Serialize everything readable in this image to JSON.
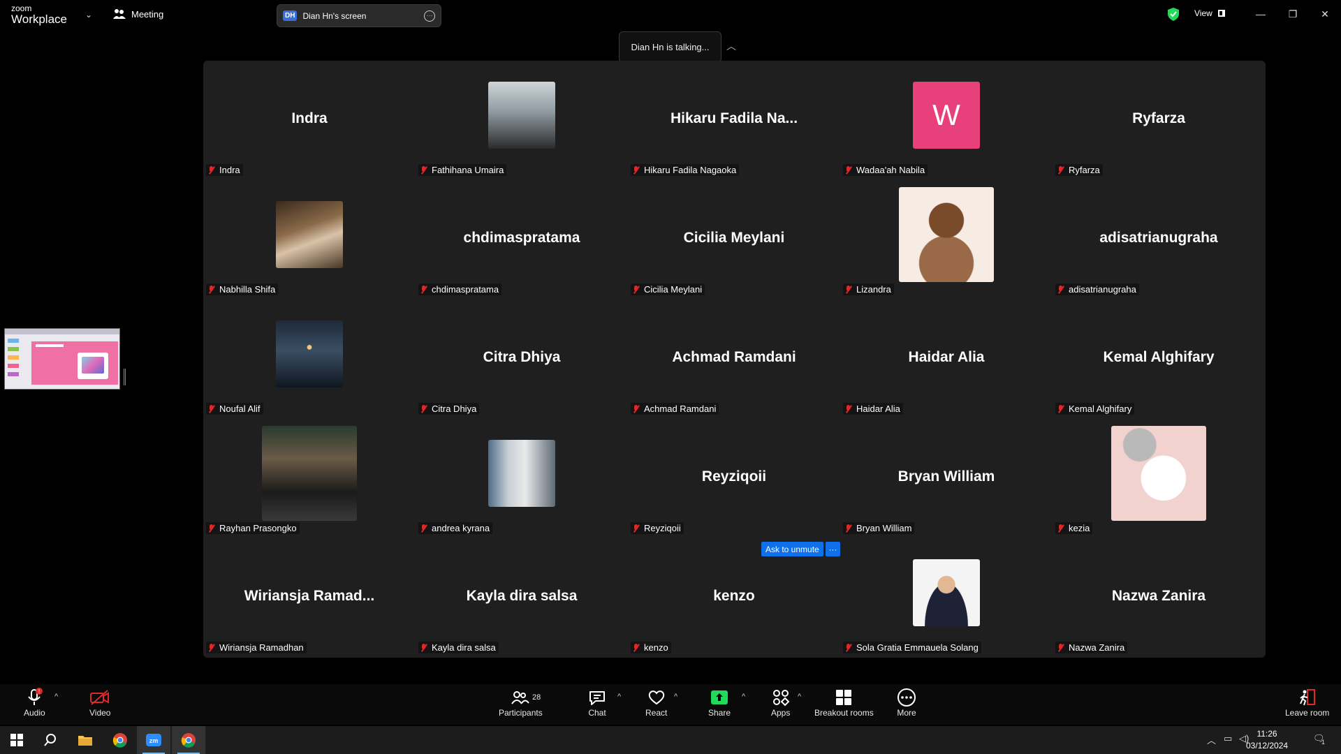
{
  "titlebar": {
    "logo_small": "zoom",
    "logo_big": "Workplace",
    "meeting_label": "Meeting",
    "screen_initials": "DH",
    "screen_label": "Dian Hn's screen",
    "view_label": "View"
  },
  "talking": {
    "text": "Dian Hn is talking..."
  },
  "tiles": [
    {
      "big": "Indra",
      "name": "Indra"
    },
    {
      "big": "",
      "name": "Fathihana Umaira",
      "photo": "photo-hijab"
    },
    {
      "big": "Hikaru  Fadila  Na...",
      "name": "Hikaru Fadila Nagaoka"
    },
    {
      "big": "W",
      "name": "Wadaa'ah Nabila",
      "photo": "avatar-w"
    },
    {
      "big": "Ryfarza",
      "name": "Ryfarza"
    },
    {
      "big": "",
      "name": "Nabhilla Shifa",
      "photo": "photo-cafe"
    },
    {
      "big": "chdimaspratama",
      "name": "chdimaspratama"
    },
    {
      "big": "Cicilia Meylani",
      "name": "Cicilia Meylani"
    },
    {
      "big": "",
      "name": "Lizandra",
      "photo": "photo-illustration"
    },
    {
      "big": "adisatrianugraha",
      "name": "adisatrianugraha"
    },
    {
      "big": "",
      "name": "Noufal Alif",
      "photo": "photo-sea"
    },
    {
      "big": "Citra Dhiya",
      "name": "Citra Dhiya"
    },
    {
      "big": "Achmad Ramdani",
      "name": "Achmad Ramdani"
    },
    {
      "big": "Haidar Alia",
      "name": "Haidar Alia"
    },
    {
      "big": "Kemal Alghifary",
      "name": "Kemal Alghifary"
    },
    {
      "big": "",
      "name": "Rayhan Prasongko",
      "photo": "photo-group"
    },
    {
      "big": "",
      "name": "andrea kyrana",
      "photo": "photo-mirror"
    },
    {
      "big": "Reyziqoii",
      "name": "Reyziqoii"
    },
    {
      "big": "Bryan William",
      "name": "Bryan William"
    },
    {
      "big": "",
      "name": "kezia",
      "photo": "photo-hamster"
    },
    {
      "big": "Wiriansja  Ramad...",
      "name": "Wiriansja Ramadhan"
    },
    {
      "big": "Kayla dira salsa",
      "name": "Kayla dira salsa"
    },
    {
      "big": "kenzo",
      "name": "kenzo"
    },
    {
      "big": "",
      "name": "Sola Gratia Emmauela Solang",
      "photo": "photo-formal"
    },
    {
      "big": "Nazwa Zanira",
      "name": "Nazwa Zanira"
    }
  ],
  "ask_unmute": {
    "label": "Ask to unmute",
    "more": "···"
  },
  "toolbar": {
    "audio": "Audio",
    "video": "Video",
    "participants": "Participants",
    "participants_count": "28",
    "chat": "Chat",
    "react": "React",
    "share": "Share",
    "apps": "Apps",
    "breakout": "Breakout rooms",
    "more": "More",
    "leave": "Leave room"
  },
  "taskbar": {
    "time": "11:26",
    "date": "03/12/2024",
    "notif_count": "1"
  },
  "colors": {
    "toolbar_bg": "#0a0a0a",
    "gallery_bg": "#1f1f1f",
    "share_green": "#23d959",
    "muted_red": "#e02828",
    "avatar_w": "#e8407a",
    "accent_blue": "#0e71eb"
  }
}
